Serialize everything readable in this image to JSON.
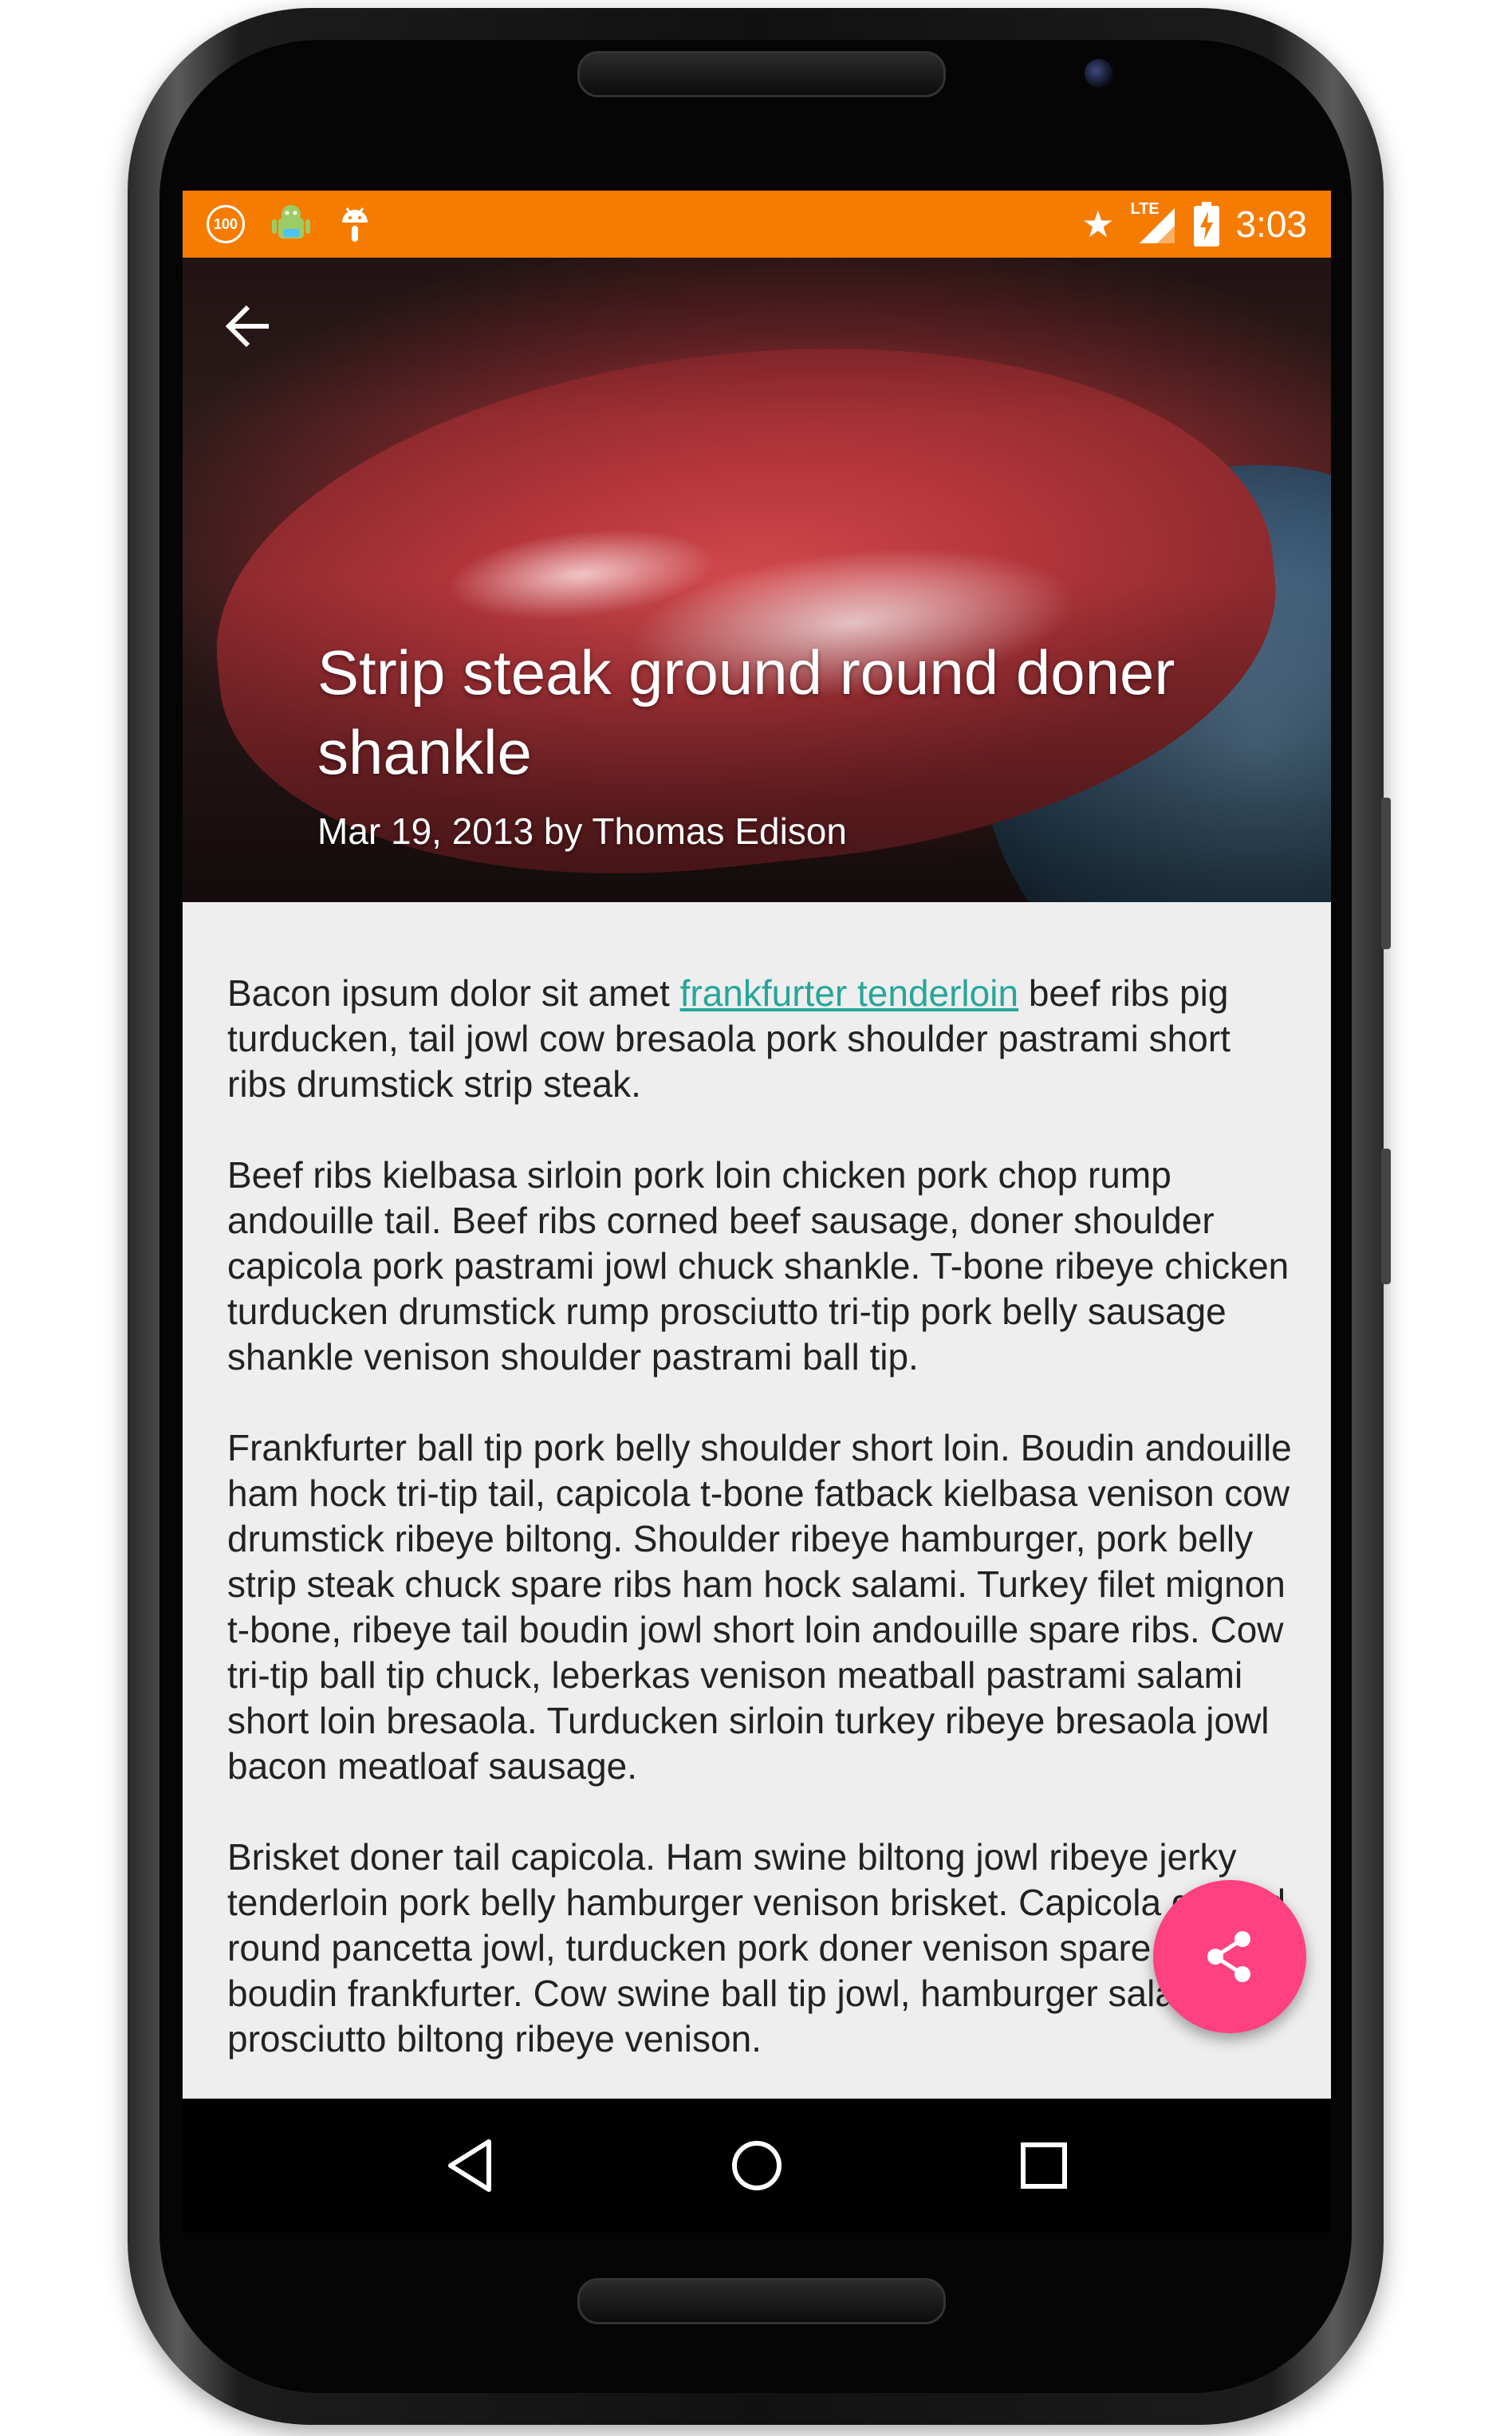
{
  "status_bar": {
    "notification_badge": "100",
    "time": "3:03",
    "network": "LTE",
    "icons": [
      "notification-100-icon",
      "android-robot-icon",
      "android-head-icon",
      "star-icon",
      "signal-icon",
      "battery-charging-icon"
    ]
  },
  "header": {
    "back_icon": "arrow-back-icon",
    "title": "Strip steak ground round doner shankle",
    "meta": "Mar 19, 2013 by Thomas Edison"
  },
  "article": {
    "p1_before": "Bacon ipsum dolor sit amet ",
    "p1_link": "frankfurter tenderloin",
    "p1_after": " beef ribs pig turducken, tail jowl cow bresaola pork shoulder pastrami short ribs drumstick strip steak.",
    "p2": "Beef ribs kielbasa sirloin pork loin chicken pork chop rump andouille tail. Beef ribs corned beef sausage, doner shoulder capicola pork pastrami jowl chuck shankle. T-bone ribeye chicken turducken drumstick rump prosciutto tri-tip pork belly sausage shankle venison shoulder pastrami ball tip.",
    "p3": "Frankfurter ball tip pork belly shoulder short loin. Boudin andouille ham hock tri-tip tail, capicola t-bone fatback kielbasa venison cow drumstick ribeye biltong. Shoulder ribeye hamburger, pork belly strip steak chuck spare ribs ham hock salami. Turkey filet mignon t-bone, ribeye tail boudin jowl short loin andouille spare ribs. Cow tri-tip ball tip chuck, leberkas venison meatball pastrami salami short loin bresaola. Turducken sirloin turkey ribeye bresaola jowl bacon meatloaf sausage.",
    "p4": "Brisket doner tail capicola. Ham swine biltong jowl ribeye jerky tenderloin pork belly hamburger venison brisket. Capicola ground round pancetta jowl, turducken pork doner venison spare ribs boudin frankfurter. Cow swine ball tip jowl, hamburger salami prosciutto biltong ribeye venison."
  },
  "fab": {
    "icon": "share-icon",
    "color": "#ff4081"
  },
  "nav_bar": {
    "icons": [
      "back-triangle-icon",
      "home-circle-icon",
      "recents-square-icon"
    ]
  },
  "colors": {
    "status_bar": "#f57c00",
    "link": "#26a69a",
    "content_background": "#eeeeee"
  }
}
